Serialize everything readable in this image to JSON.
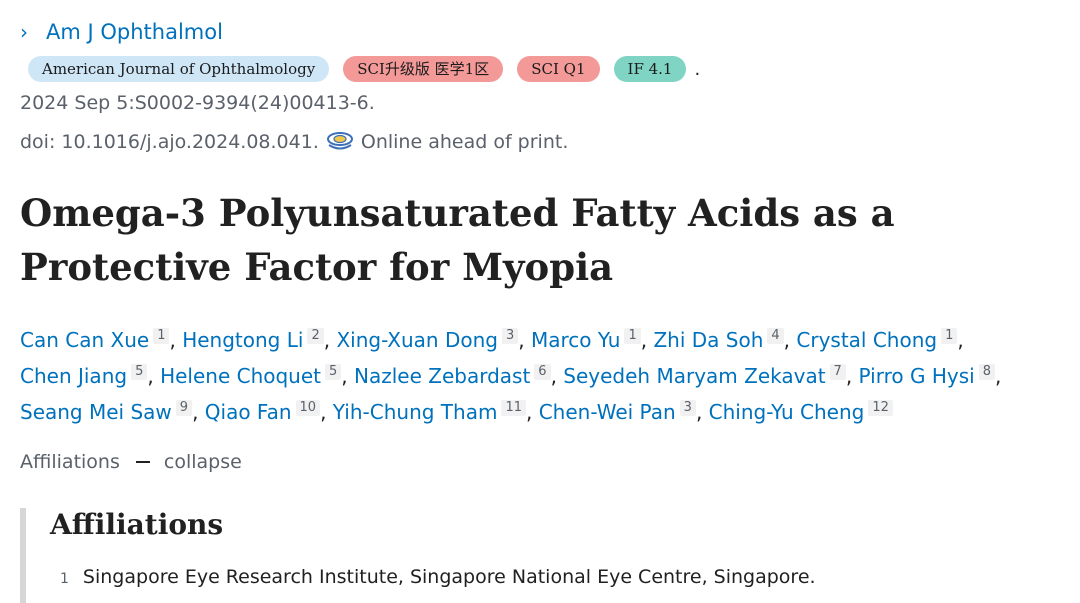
{
  "journal": {
    "chevron": "›",
    "short_name": "Am J Ophthalmol"
  },
  "badges": {
    "journal_full": "American Journal of Ophthalmology",
    "sci_upgrade": "SCI升级版 医学1区",
    "sci_q": "SCI Q1",
    "impact_factor": "IF 4.1",
    "trailing": "."
  },
  "citation": {
    "date_line": "2024 Sep 5:S0002-9394(24)00413-6.",
    "doi": "doi: 10.1016/j.ajo.2024.08.041.",
    "status": "Online ahead of print."
  },
  "article": {
    "title": "Omega-3 Polyunsaturated Fatty Acids as a Protective Factor for Myopia"
  },
  "authors": [
    {
      "name": "Can Can Xue",
      "aff": "1"
    },
    {
      "name": "Hengtong Li",
      "aff": "2"
    },
    {
      "name": "Xing-Xuan Dong",
      "aff": "3"
    },
    {
      "name": "Marco Yu",
      "aff": "1"
    },
    {
      "name": "Zhi Da Soh",
      "aff": "4"
    },
    {
      "name": "Crystal Chong",
      "aff": "1"
    },
    {
      "name": "Chen Jiang",
      "aff": "5"
    },
    {
      "name": "Helene Choquet",
      "aff": "5"
    },
    {
      "name": "Nazlee Zebardast",
      "aff": "6"
    },
    {
      "name": "Seyedeh Maryam Zekavat",
      "aff": "7"
    },
    {
      "name": "Pirro G Hysi",
      "aff": "8"
    },
    {
      "name": "Seang Mei Saw",
      "aff": "9"
    },
    {
      "name": "Qiao Fan",
      "aff": "10"
    },
    {
      "name": "Yih-Chung Tham",
      "aff": "11"
    },
    {
      "name": "Chen-Wei Pan",
      "aff": "3"
    },
    {
      "name": "Ching-Yu Cheng",
      "aff": "12"
    }
  ],
  "affiliations_toggle": {
    "label": "Affiliations",
    "action": "collapse"
  },
  "affiliations": {
    "heading": "Affiliations",
    "items": [
      {
        "num": "1",
        "text": "Singapore Eye Research Institute, Singapore National Eye Centre, Singapore."
      }
    ]
  },
  "colors": {
    "link": "#0071bc",
    "badge_blue": "#cfe6f7",
    "badge_pink": "#f39a98",
    "badge_teal": "#7fd4c4"
  },
  "icons": {
    "oa_icon": "open-access-icon"
  }
}
